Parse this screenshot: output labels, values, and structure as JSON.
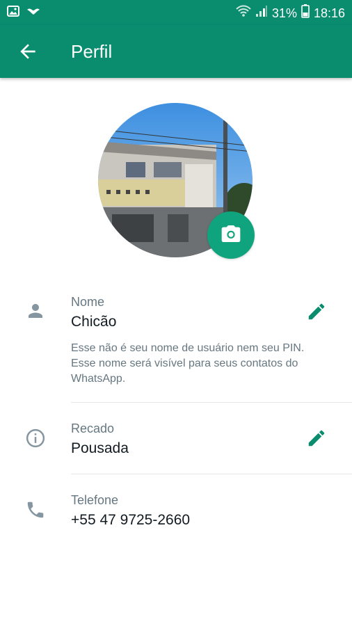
{
  "status_bar": {
    "battery": "31%",
    "time": "18:16",
    "icons": [
      "image-icon",
      "bird-icon",
      "wifi-icon",
      "signal-icon",
      "battery-icon"
    ]
  },
  "app_bar": {
    "title": "Perfil",
    "back_icon": "arrow-left-icon"
  },
  "profile": {
    "camera_icon": "camera-icon"
  },
  "fields": {
    "name": {
      "label": "Nome",
      "value": "Chicão",
      "hint": "Esse não é seu nome de usuário nem seu PIN. Esse nome será visível para seus contatos do WhatsApp.",
      "icon": "person-icon",
      "edit_icon": "pencil-icon"
    },
    "about": {
      "label": "Recado",
      "value": "Pousada",
      "icon": "info-icon",
      "edit_icon": "pencil-icon"
    },
    "phone": {
      "label": "Telefone",
      "value": "+55 47 9725-2660",
      "icon": "phone-icon"
    }
  },
  "colors": {
    "primary": "#0a8c6f",
    "accent": "#0fa47e",
    "icon_gray": "#8696a0",
    "text_secondary": "#667781"
  }
}
